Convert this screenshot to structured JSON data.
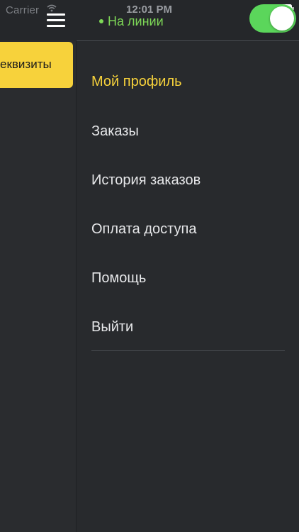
{
  "status_bar": {
    "carrier": "Carrier",
    "time": "12:01 PM"
  },
  "header": {
    "online_status": "На линии",
    "online_toggle_on": true,
    "online_color": "#7ed957",
    "toggle_color": "#5bd65b"
  },
  "requisites_button": {
    "label": "еквизиты"
  },
  "menu": {
    "items": [
      {
        "label": "Мой профиль",
        "active": true
      },
      {
        "label": "Заказы",
        "active": false
      },
      {
        "label": "История заказов",
        "active": false
      },
      {
        "label": "Оплата доступа",
        "active": false
      },
      {
        "label": "Помощь",
        "active": false
      },
      {
        "label": "Выйти",
        "active": false
      }
    ],
    "active_color": "#f7d23b"
  },
  "icons": {
    "menu": "hamburger-menu-icon",
    "wifi": "wifi-icon",
    "battery": "battery-icon"
  }
}
